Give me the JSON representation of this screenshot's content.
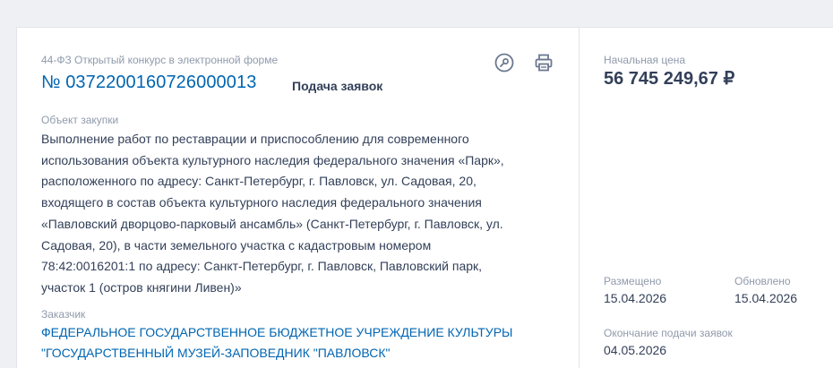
{
  "procurement": {
    "law_type": "44-ФЗ Открытый конкурс в электронной форме",
    "number": "№ 0372200160726000013",
    "status": "Подача заявок"
  },
  "object": {
    "label": "Объект закупки",
    "text": "Выполнение работ по реставрации и приспособлению для современного использования объекта культурного наследия федерального значения «Парк», расположенного по адресу: Санкт-Петербург, г. Павловск, ул. Садовая, 20, входящего в состав объекта культурного наследия федерального значения «Павловский дворцово-парковый ансамбль» (Санкт-Петербург, г. Павловск, ул. Садовая, 20), в части земельного участка с кадастровым номером 78:42:0016201:1 по адресу: Санкт-Петербург, г. Павловск, Павловский парк, участок 1 (остров княгини Ливен)»"
  },
  "customer": {
    "label": "Заказчик",
    "name": "ФЕДЕРАЛЬНОЕ ГОСУДАРСТВЕННОЕ БЮДЖЕТНОЕ УЧРЕЖДЕНИЕ КУЛЬТУРЫ \"ГОСУДАРСТВЕННЫЙ МУЗЕЙ-ЗАПОВЕДНИК \"ПАВЛОВСК\""
  },
  "price": {
    "label": "Начальная цена",
    "value": "56 745 249,67 ₽"
  },
  "dates": {
    "posted_label": "Размещено",
    "posted_value": "15.04.2026",
    "updated_label": "Обновлено",
    "updated_value": "15.04.2026",
    "deadline_label": "Окончание подачи заявок",
    "deadline_value": "04.05.2026"
  },
  "icons": {
    "watch": "watch-icon",
    "print": "print-icon"
  },
  "colors": {
    "link": "#0065b2",
    "text": "#334059",
    "muted": "#8f9aab"
  }
}
